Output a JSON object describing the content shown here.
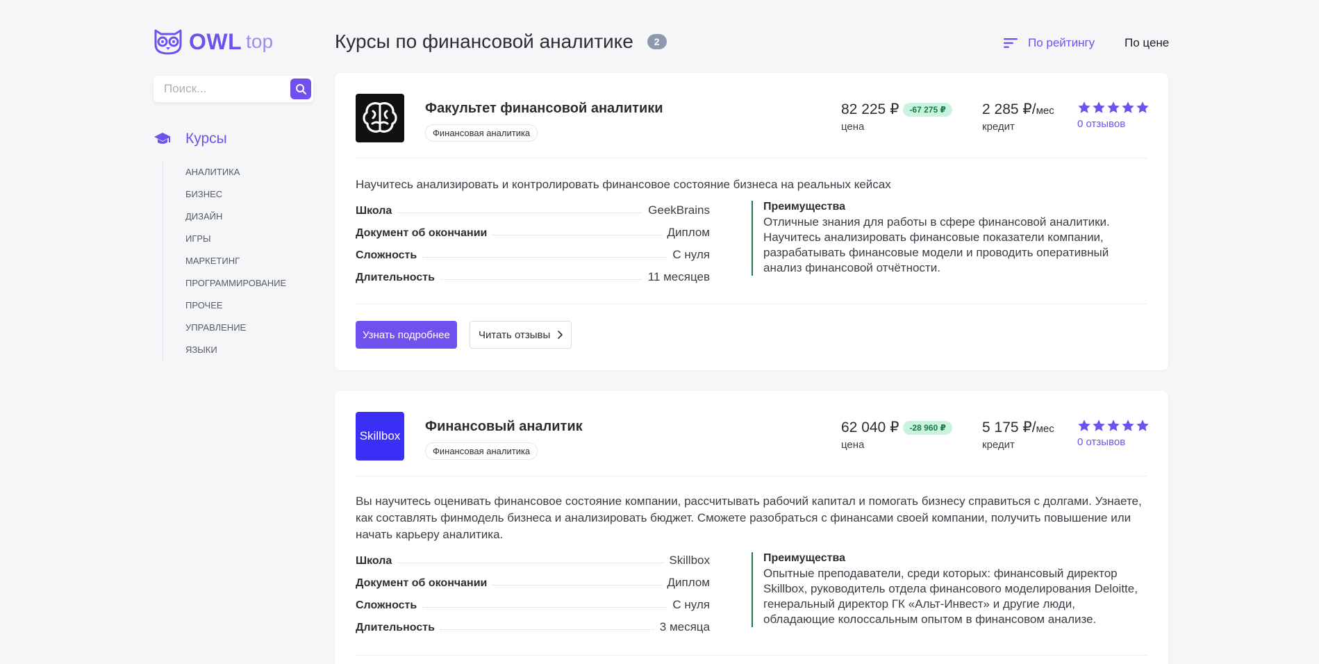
{
  "logo": {
    "brand": "OWL",
    "suffix": "top"
  },
  "search": {
    "placeholder": "Поиск..."
  },
  "nav": {
    "heading": "Курсы",
    "items": [
      "Аналитика",
      "Бизнес",
      "Дизайн",
      "Игры",
      "Маркетинг",
      "Программирование",
      "Прочее",
      "Управление",
      "Языки"
    ]
  },
  "header": {
    "title": "Курсы по финансовой аналитике",
    "count": "2",
    "sort_rating": "По рейтингу",
    "sort_price": "По цене"
  },
  "courses": [
    {
      "name": "Факультет финансовой аналитики",
      "tag": "Финансовая аналитика",
      "price": "82 225 ₽",
      "discount": "-67 275 ₽",
      "price_label": "цена",
      "credit": "2 285 ₽/",
      "credit_unit": "мес",
      "credit_label": "кредит",
      "rating": 5,
      "reviews": "0 отзывов",
      "description": "Научитесь анализировать и контролировать финансовое состояние бизнеса на реальных кейсах",
      "specs": [
        {
          "k": "Школа",
          "v": "GeekBrains"
        },
        {
          "k": "Документ об окончании",
          "v": "Диплом"
        },
        {
          "k": "Сложность",
          "v": "С нуля"
        },
        {
          "k": "Длительность",
          "v": "11 месяцев"
        }
      ],
      "adv_title": "Преимущества",
      "adv_text": "Отличные знания для работы в сфере финансовой аналитики. Научитесь анализировать финансовые показатели компании, разрабатывать финансовые модели и проводить оперативный анализ финансовой отчётности.",
      "btn_more": "Узнать подробнее",
      "btn_reviews": "Читать отзывы"
    },
    {
      "name": "Финансовый аналитик",
      "logo_text": "Skillbox",
      "tag": "Финансовая аналитика",
      "price": "62 040 ₽",
      "discount": "-28 960 ₽",
      "price_label": "цена",
      "credit": "5 175 ₽/",
      "credit_unit": "мес",
      "credit_label": "кредит",
      "rating": 5,
      "reviews": "0 отзывов",
      "description": "Вы научитесь оценивать финансовое состояние компании, рассчитывать рабочий капитал и помогать бизнесу справиться с долгами. Узнаете, как составлять финмодель бизнеса и анализировать бюджет. Сможете разобраться с финансами своей компании, получить повышение или начать карьеру аналитика.",
      "specs": [
        {
          "k": "Школа",
          "v": "Skillbox"
        },
        {
          "k": "Документ об окончании",
          "v": "Диплом"
        },
        {
          "k": "Сложность",
          "v": "С нуля"
        },
        {
          "k": "Длительность",
          "v": "3 месяца"
        }
      ],
      "adv_title": "Преимущества",
      "adv_text": "Опытные преподаватели, среди которых: финансовый директор Skillbox, руководитель отдела финансового моделирования Deloitte, генеральный директор ГК «Альт-Инвест» и другие люди, обладающие колоссальным опытом в финансовом анализе."
    }
  ],
  "colors": {
    "accent": "#6f52ed",
    "discount_bg": "#c8f3de",
    "discount_text": "#16794a",
    "advantage_border": "#1e7a46"
  }
}
